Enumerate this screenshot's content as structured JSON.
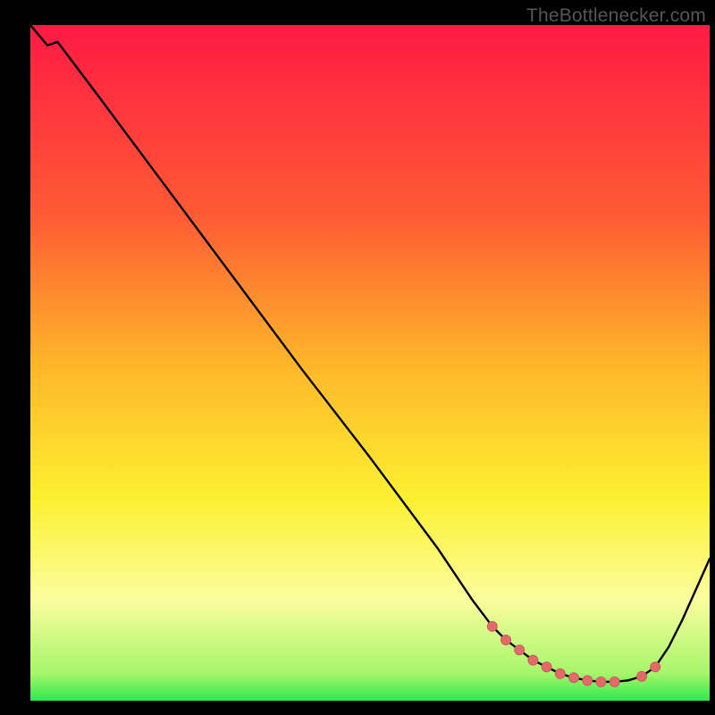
{
  "watermark": "TheBottlenecker.com",
  "colors": {
    "red": "#ff1a44",
    "orange": "#ff9a2a",
    "yellow": "#fcf030",
    "paleYellow": "#fbfd9e",
    "green": "#2ee84f",
    "dotFill": "#e26a6a",
    "dotStroke": "#cc5c5c",
    "line": "#000000"
  },
  "chart_data": {
    "type": "line",
    "title": "",
    "xlabel": "",
    "ylabel": "",
    "xlim": [
      0,
      100
    ],
    "ylim": [
      0,
      100
    ],
    "series": [
      {
        "name": "bottleneck-curve",
        "x": [
          0,
          2.5,
          4,
          10,
          20,
          30,
          40,
          50,
          60,
          65,
          68,
          70,
          72,
          74,
          76,
          78,
          80,
          82,
          84,
          86,
          88,
          90,
          92,
          94,
          96,
          98,
          100
        ],
        "y": [
          100,
          97,
          97.5,
          89.5,
          76,
          62.5,
          49,
          36,
          22.5,
          15,
          11,
          9,
          7.5,
          6,
          5,
          4,
          3.4,
          3,
          2.8,
          2.8,
          3,
          3.6,
          5,
          8,
          12,
          16.5,
          21
        ]
      }
    ],
    "markers": {
      "name": "marker-dots",
      "x": [
        68,
        70,
        72,
        74,
        76,
        78,
        80,
        82,
        84,
        86,
        90,
        92
      ],
      "y": [
        11,
        9,
        7.5,
        6,
        5,
        4,
        3.4,
        3,
        2.8,
        2.8,
        3.6,
        5
      ]
    },
    "gradient_stops": [
      {
        "pos": 0.0,
        "color": "#ff1a44"
      },
      {
        "pos": 0.28,
        "color": "#ff5a34"
      },
      {
        "pos": 0.5,
        "color": "#ffb52a"
      },
      {
        "pos": 0.7,
        "color": "#fcf030"
      },
      {
        "pos": 0.85,
        "color": "#fbfd9e"
      },
      {
        "pos": 0.96,
        "color": "#a6f66a"
      },
      {
        "pos": 1.0,
        "color": "#2ee84f"
      }
    ]
  }
}
